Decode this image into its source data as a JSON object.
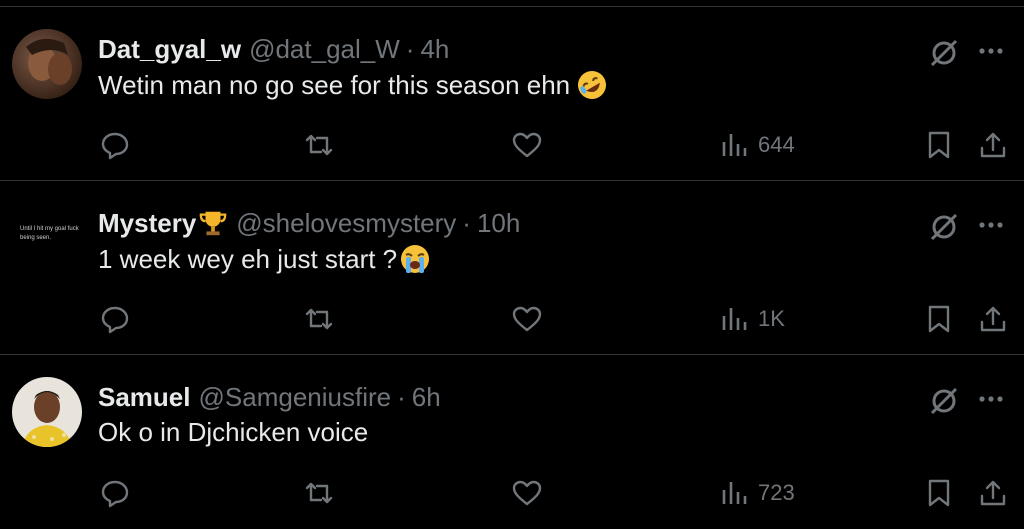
{
  "tweets": [
    {
      "name": "Dat_gyal_w",
      "handle": "@dat_gal_W",
      "separator": "·",
      "time": "4h",
      "text": "Wetin man no go see for this season ehn",
      "emoji": "rolling-on-floor-laughing-emoji",
      "views": "644",
      "avatar_icon": "user-avatar-photo"
    },
    {
      "name": "Mystery",
      "name_emoji": "trophy-emoji",
      "handle": "@shelovesmystery",
      "separator": "·",
      "time": "10h",
      "text": "1 week wey eh just start ?",
      "emoji": "loudly-crying-face-emoji",
      "views": "1K",
      "avatar_text": "Until I hit my goal fuck being seen."
    },
    {
      "name": "Samuel",
      "handle": "@Samgeniusfire",
      "separator": "·",
      "time": "6h",
      "text": "Ok o in Djchicken voice",
      "views": "723",
      "avatar_icon": "user-avatar-photo"
    }
  ],
  "colors": {
    "background": "#000000",
    "text": "#e7e9ea",
    "secondary": "#71767b",
    "divider": "#2f3336"
  }
}
